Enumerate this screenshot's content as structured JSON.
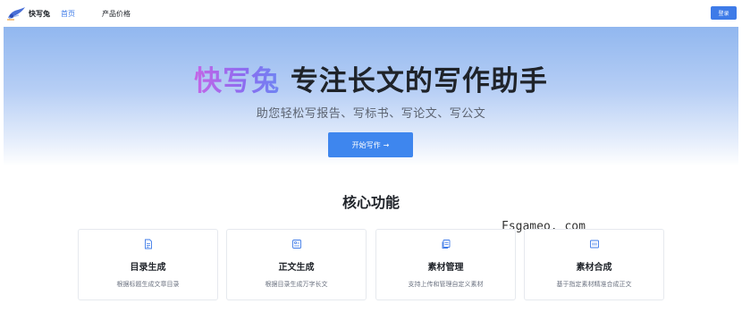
{
  "app": {
    "name": "快写兔"
  },
  "nav": {
    "items": [
      {
        "label": "首页"
      },
      {
        "label": "产品价格"
      }
    ],
    "login_label": "登录"
  },
  "hero": {
    "brand": "快写兔",
    "tagline": " 专注长文的写作助手",
    "subtitle": "助您轻松写报告、写标书、写论文、写公文",
    "cta_label": "开始写作",
    "cta_arrow": "→"
  },
  "features": {
    "title": "核心功能",
    "cards": [
      {
        "title": "目录生成",
        "desc": "根据标题生成文章目录",
        "icon": "document-icon"
      },
      {
        "title": "正文生成",
        "desc": "根据目录生成万字长文",
        "icon": "image-text-icon"
      },
      {
        "title": "素材管理",
        "desc": "支持上传和管理自定义素材",
        "icon": "files-icon"
      },
      {
        "title": "素材合成",
        "desc": "基于指定素材精准合成正文",
        "icon": "compose-icon"
      }
    ]
  },
  "watermark": "Fsgameo. com",
  "colors": {
    "accent": "#3e7be8",
    "button": "#3e86ee",
    "brand_gradient_start": "#c466e6",
    "brand_gradient_end": "#6f85f2"
  }
}
